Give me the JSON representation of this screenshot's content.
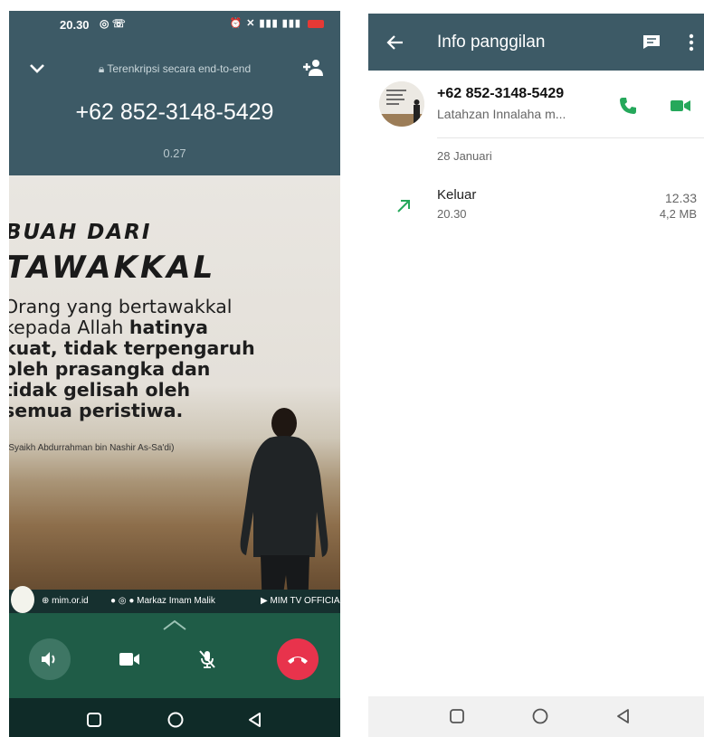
{
  "call_screen": {
    "status_time": "20.30",
    "encryption_text": "Terenkripsi secara end-to-end",
    "caller_number": "+62 852-3148-5429",
    "call_duration": "0.27",
    "wallpaper": {
      "title_line_1": "BUAH DARI",
      "title_line_2": "TAWAKKAL",
      "body_1": "Orang yang bertawakkal",
      "body_2": "kepada Allah ",
      "body_2_bold": "hatinya",
      "body_3": "kuat, tidak terpengaruh",
      "body_4": "oleh prasangka dan",
      "body_5": "tidak gelisah oleh",
      "body_6": "semua peristiwa.",
      "source": "(Syaikh Abdurrahman bin Nashir As-Sa'di)",
      "brand_site": "mim.or.id",
      "brand_social": "Markaz Imam Malik",
      "brand_tv": "MIM TV OFFICIAL"
    },
    "controls": {
      "speaker": "speaker-icon",
      "video": "video-camera-icon",
      "mute": "mic-off-icon",
      "end_call": "end-call-icon"
    },
    "colors": {
      "header": "#3d5a66",
      "controls": "#1f5c47",
      "end_call": "#e8334c"
    }
  },
  "info_screen": {
    "title": "Info panggilan",
    "contact": {
      "name": "+62 852-3148-5429",
      "status": "Latahzan Innalaha m..."
    },
    "date": "28 Januari",
    "entries": [
      {
        "type": "Keluar",
        "time": "20.30",
        "duration": "12.33",
        "size": "4,2 MB"
      }
    ],
    "colors": {
      "accent": "#25a85b",
      "header": "#3d5a66"
    }
  }
}
